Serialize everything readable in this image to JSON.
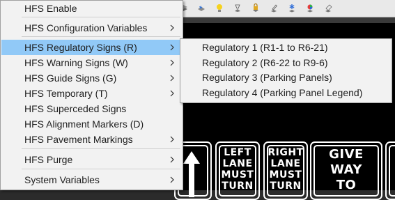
{
  "toolbar": {
    "icons": [
      "layer-stack-icon",
      "star-layer-icon",
      "lightbulb-icon",
      "pushpin-icon",
      "lock-icon",
      "pen-pin-icon",
      "snowflake-icon",
      "color-wheel-icon",
      "eraser-pin-icon"
    ]
  },
  "context_menu": {
    "items": [
      {
        "label": "HFS Enable",
        "submenu": false
      },
      {
        "label": "HFS Configuration Variables",
        "submenu": true
      },
      {
        "label": "HFS Regulatory Signs (R)",
        "submenu": true,
        "highlighted": true
      },
      {
        "label": "HFS Warning Signs (W)",
        "submenu": true
      },
      {
        "label": "HFS Guide Signs (G)",
        "submenu": true
      },
      {
        "label": "HFS Temporary (T)",
        "submenu": true
      },
      {
        "label": "HFS Superceded Signs",
        "submenu": false
      },
      {
        "label": "HFS Alignment Markers (D)",
        "submenu": false
      },
      {
        "label": "HFS Pavement Markings",
        "submenu": true
      },
      {
        "label": "HFS Purge",
        "submenu": true
      },
      {
        "label": "System Variables",
        "submenu": true
      }
    ]
  },
  "submenu": {
    "items": [
      "Regulatory 1 (R1-1 to R6-21)",
      "Regulatory 2 (R6-22 to R9-6)",
      "Regulatory 3 (Parking Panels)",
      "Regulatory 4 (Parking Panel Legend)"
    ]
  },
  "canvas_signs": {
    "left_turn": [
      "LEFT",
      "LANE",
      "MUST",
      "TURN"
    ],
    "right_turn": [
      "RIGHT",
      "LANE",
      "MUST",
      "TURN"
    ],
    "give_way": [
      "GIVE WAY",
      "TO"
    ]
  },
  "colors": {
    "highlight": "#91c9f7",
    "menu_bg": "#f2f2f2",
    "canvas_bg": "#000000"
  }
}
